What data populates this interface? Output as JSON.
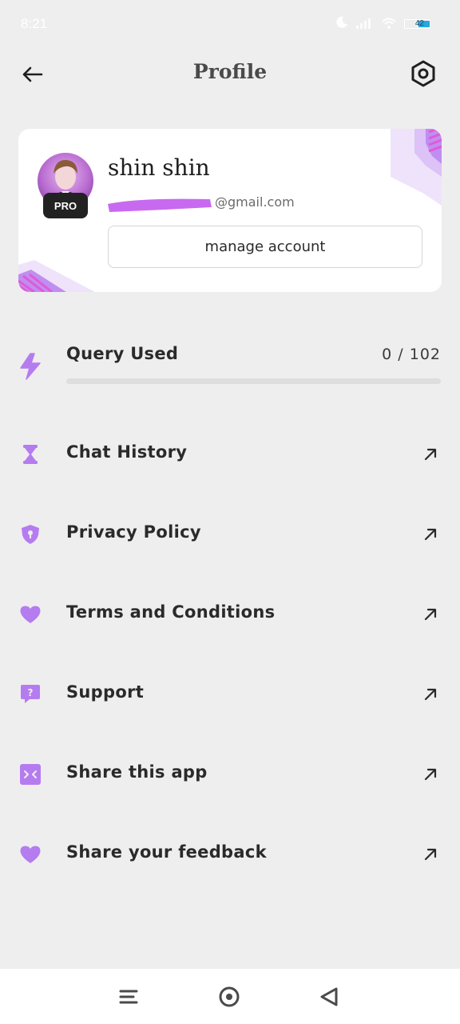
{
  "status_bar": {
    "time": "8:21",
    "battery_level": "42",
    "icons": [
      "moon-icon",
      "signal-icon",
      "wifi-icon",
      "battery-icon"
    ]
  },
  "header": {
    "title": "Profile",
    "back_icon": "arrow-left-icon",
    "settings_icon": "settings-hexagon-icon"
  },
  "profile": {
    "name": "shin shin",
    "email": "@gmail.com",
    "badge": "PRO",
    "manage_label": "manage account"
  },
  "usage": {
    "label": "Query Used",
    "value_text": "0 / 102",
    "used": 0,
    "total": 102,
    "icon": "lightning-icon"
  },
  "menu": [
    {
      "label": "Chat History",
      "icon": "hourglass-icon"
    },
    {
      "label": "Privacy Policy",
      "icon": "shield-lock-icon"
    },
    {
      "label": "Terms and Conditions",
      "icon": "heart-icon"
    },
    {
      "label": "Support",
      "icon": "help-chat-icon"
    },
    {
      "label": "Share this app",
      "icon": "share-box-icon"
    },
    {
      "label": "Share your feedback",
      "icon": "heart-icon"
    }
  ],
  "nav": [
    "menu-lines-icon",
    "home-circle-icon",
    "back-triangle-icon"
  ],
  "colors": {
    "background": "#efeeef",
    "accent": "#b57cf0",
    "card": "#ffffff",
    "text": "#2a2a2a"
  }
}
